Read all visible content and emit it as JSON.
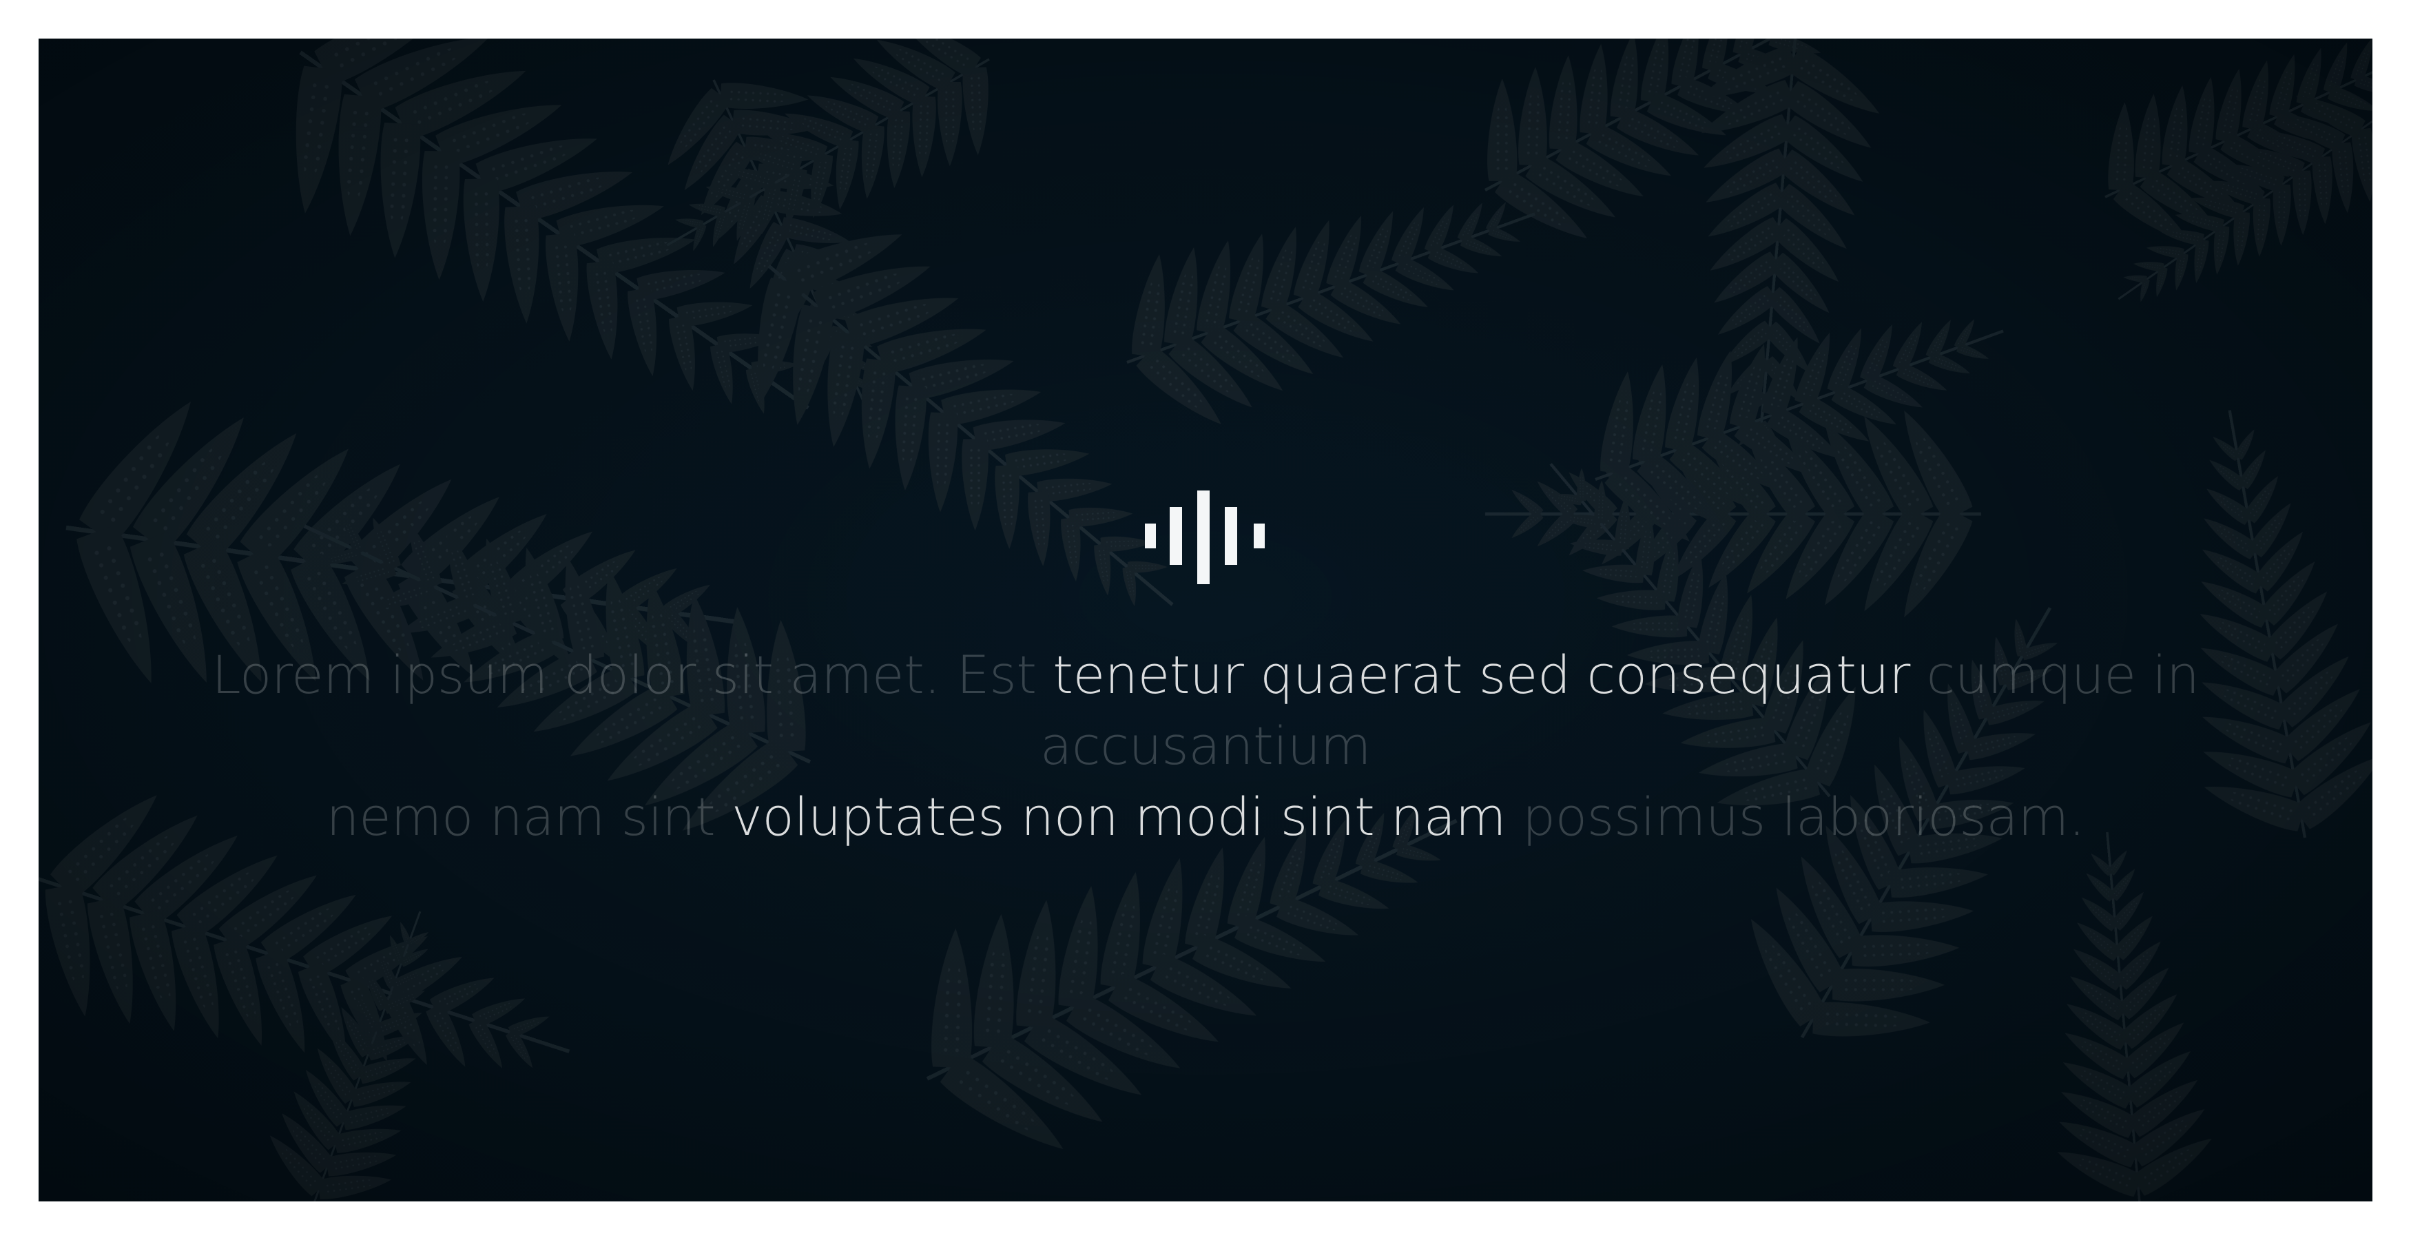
{
  "hero": {
    "logo_icon": "audio-bars-icon",
    "caption_line1_faded_start": "Lorem ipsum dolor sit amet. Est",
    "caption_line1_highlight": " tenetur quaerat sed consequatur",
    "caption_line1_faded_end": " cumque in accusantium",
    "caption_line2_faded_start": "nemo nam sint",
    "caption_line2_highlight": " voluptates non modi sint nam",
    "caption_line2_faded_end": " possimus laboriosam.",
    "background_image": "dark-fern-leaves",
    "colors": {
      "background": "#061520",
      "text_highlight": "#e6eaec",
      "text_faded": "#34414a",
      "logo": "#ffffff"
    }
  }
}
